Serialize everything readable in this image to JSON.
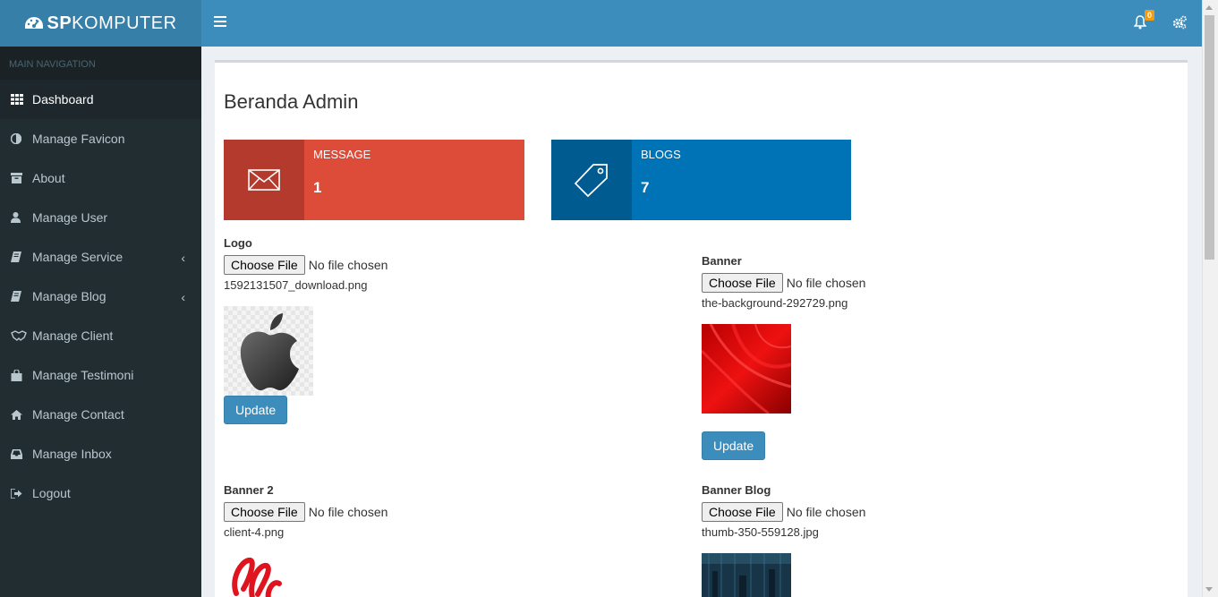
{
  "header": {
    "logo_bold": "SP",
    "logo_light": "KOMPUTER",
    "notification_count": "0"
  },
  "sidebar": {
    "header": "MAIN NAVIGATION",
    "items": [
      {
        "label": "Dashboard",
        "icon": "grid-icon",
        "active": true
      },
      {
        "label": "Manage Favicon",
        "icon": "adjust-icon"
      },
      {
        "label": "About",
        "icon": "archive-icon"
      },
      {
        "label": "Manage User",
        "icon": "user-icon"
      },
      {
        "label": "Manage Service",
        "icon": "book-icon",
        "has_submenu": true
      },
      {
        "label": "Manage Blog",
        "icon": "book-icon",
        "has_submenu": true
      },
      {
        "label": "Manage Client",
        "icon": "handshake-icon"
      },
      {
        "label": "Manage Testimoni",
        "icon": "shopping-bag-icon"
      },
      {
        "label": "Manage Contact",
        "icon": "home-icon"
      },
      {
        "label": "Manage Inbox",
        "icon": "inbox-icon"
      },
      {
        "label": "Logout",
        "icon": "sign-out-icon"
      }
    ]
  },
  "main": {
    "title": "Beranda Admin",
    "boxes": [
      {
        "label": "MESSAGE",
        "value": "1",
        "icon": "envelope-icon",
        "color": "#dd4b39"
      },
      {
        "label": "BLOGS",
        "value": "7",
        "icon": "tag-icon",
        "color": "#0073b7"
      }
    ],
    "fields": [
      {
        "label": "Logo",
        "button": "Choose File",
        "status": "No file chosen",
        "filename": "1592131507_download.png",
        "update": "Update"
      },
      {
        "label": "Banner",
        "button": "Choose File",
        "status": "No file chosen",
        "filename": "the-background-292729.png",
        "update": "Update"
      },
      {
        "label": "Banner 2",
        "button": "Choose File",
        "status": "No file chosen",
        "filename": "client-4.png"
      },
      {
        "label": "Banner Blog",
        "button": "Choose File",
        "status": "No file chosen",
        "filename": "thumb-350-559128.jpg"
      }
    ]
  },
  "colors": {
    "sidebar_bg": "#222d32",
    "topbar_bg": "#3c8dbc",
    "primary_button": "#3c8dbc"
  }
}
